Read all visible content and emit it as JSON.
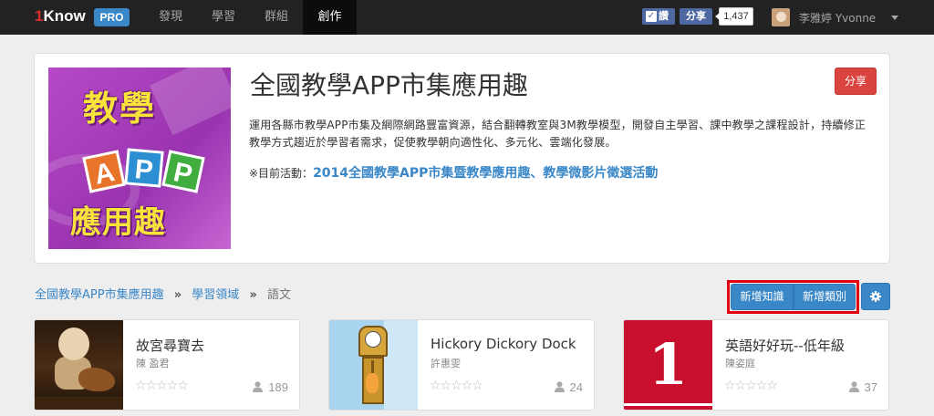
{
  "navbar": {
    "logo_prefix": "1",
    "logo_text": "Know",
    "pro_badge": "PRO",
    "items": [
      {
        "label": "發現"
      },
      {
        "label": "學習"
      },
      {
        "label": "群組"
      },
      {
        "label": "創作"
      }
    ],
    "active_item": "創作",
    "fb_like_label": "讚",
    "fb_share_label": "分享",
    "fb_count": "1,437",
    "username": "李雅婷 Yvonne"
  },
  "header": {
    "title": "全國教學APP市集應用趣",
    "share_button": "分享",
    "description": "運用各縣市教學APP市集及網際網路豐富資源，結合翻轉教室與3M教學模型，開發自主學習、課中教學之課程設計，持續修正教學方式趨近於學習者需求，促使教學朝向適性化、多元化、雲端化發展。",
    "activity_prefix": "※目前活動：",
    "activity_link": "2014全國教學APP市集暨教學應用趣、教學微影片徵選活動",
    "cover_lines": [
      "教學",
      "應用趣"
    ],
    "cover_tiles": [
      "A",
      "P",
      "P"
    ]
  },
  "breadcrumb": {
    "items": [
      "全國教學APP市集應用趣",
      "學習領域",
      "語文"
    ],
    "separator": "»"
  },
  "actions": {
    "add_knowledge": "新增知識",
    "add_category": "新增類別",
    "settings_icon": "gear-icon"
  },
  "cards": [
    {
      "title": "故宮尋寶去",
      "author": "陳 盈君",
      "stars": "☆☆☆☆☆",
      "views": "189"
    },
    {
      "title": "Hickory Dickory Dock",
      "author": "許惠雯",
      "stars": "☆☆☆☆☆",
      "views": "24"
    },
    {
      "title": "英語好好玩--低年級",
      "author": "陳姿庭",
      "stars": "☆☆☆☆☆",
      "views": "37"
    }
  ],
  "card3_thumb_numeral": "1",
  "colors": {
    "navbar_bg": "#222222",
    "accent_blue": "#3a87c8",
    "share_red": "#d9443f",
    "highlight_red": "#e3000f"
  }
}
